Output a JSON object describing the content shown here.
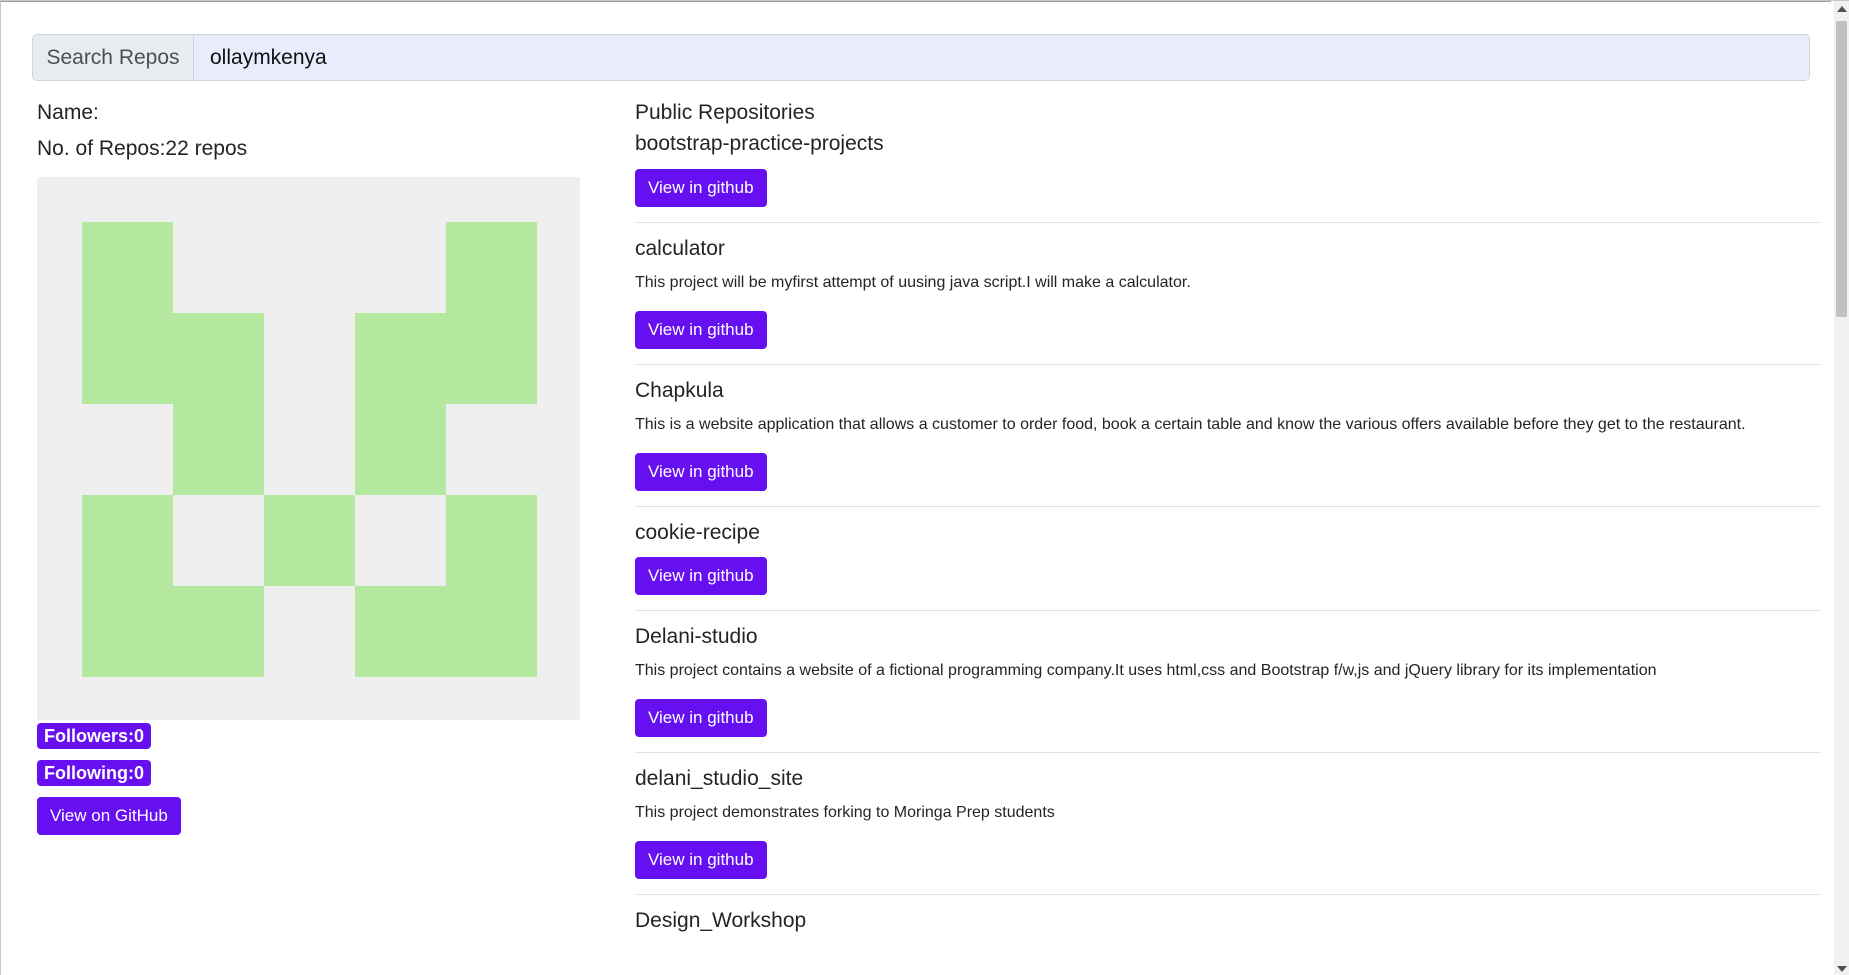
{
  "search": {
    "label": "Search Repos",
    "value": "ollaymkenya"
  },
  "profile": {
    "name_label": "Name:",
    "repos_label": "No. of Repos:22 repos",
    "followers": "Followers:0",
    "following": "Following:0",
    "view_button": "View on GitHub"
  },
  "repos_title": "Public Repositories",
  "repos": [
    {
      "name": "bootstrap-practice-projects",
      "description": "",
      "button": "View in github"
    },
    {
      "name": "calculator",
      "description": "This project will be myfirst attempt of uusing java script.I will make a calculator.",
      "button": "View in github"
    },
    {
      "name": "Chapkula",
      "description": "This is a website application that allows a customer to order food, book a certain table and know the various offers available before they get to the restaurant.",
      "button": "View in github"
    },
    {
      "name": "cookie-recipe",
      "description": "",
      "button": "View in github"
    },
    {
      "name": "Delani-studio",
      "description": "This project contains a website of a fictional programming company.It uses html,css and Bootstrap f/w,js and jQuery library for its implementation",
      "button": "View in github"
    },
    {
      "name": "delani_studio_site",
      "description": "This project demonstrates forking to Moringa Prep students",
      "button": "View in github"
    },
    {
      "name": "Design_Workshop",
      "description": "",
      "button": ""
    }
  ],
  "colors": {
    "accent": "#6610f2",
    "avatar_fill": "#b3e89e",
    "avatar_bg": "#efefef",
    "search_bg": "#e8ecfd"
  }
}
